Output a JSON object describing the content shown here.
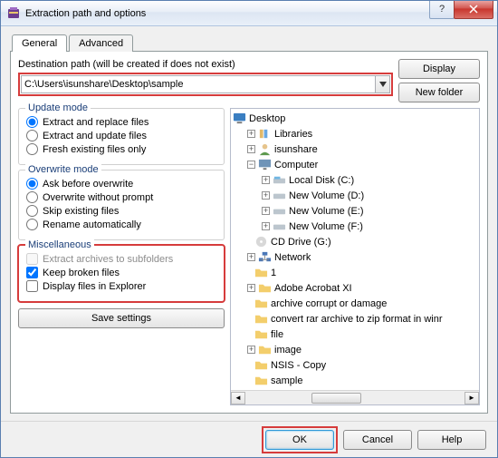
{
  "window": {
    "title": "Extraction path and options"
  },
  "tabs": {
    "general": "General",
    "advanced": "Advanced"
  },
  "dest": {
    "label": "Destination path (will be created if does not exist)",
    "value": "C:\\Users\\isunshare\\Desktop\\sample"
  },
  "buttons": {
    "display": "Display",
    "newfolder": "New folder",
    "save": "Save settings",
    "ok": "OK",
    "cancel": "Cancel",
    "help": "Help"
  },
  "update": {
    "legend": "Update mode",
    "o1": "Extract and replace files",
    "o2": "Extract and update files",
    "o3": "Fresh existing files only"
  },
  "overwrite": {
    "legend": "Overwrite mode",
    "o1": "Ask before overwrite",
    "o2": "Overwrite without prompt",
    "o3": "Skip existing files",
    "o4": "Rename automatically"
  },
  "misc": {
    "legend": "Miscellaneous",
    "o1": "Extract archives to subfolders",
    "o2": "Keep broken files",
    "o3": "Display files in Explorer"
  },
  "tree": {
    "root": "Desktop",
    "libraries": "Libraries",
    "isunshare": "isunshare",
    "computer": "Computer",
    "localc": "Local Disk (C:)",
    "vold": "New Volume (D:)",
    "vole": "New Volume (E:)",
    "volf": "New Volume (F:)",
    "cdg": "CD Drive (G:)",
    "network": "Network",
    "one": "1",
    "adobe": "Adobe Acrobat XI",
    "archivec": "archive corrupt or damage",
    "convert": "convert rar archive to zip format in winr",
    "file": "file",
    "image": "image",
    "nsis": "NSIS - Copy",
    "sample": "sample"
  }
}
